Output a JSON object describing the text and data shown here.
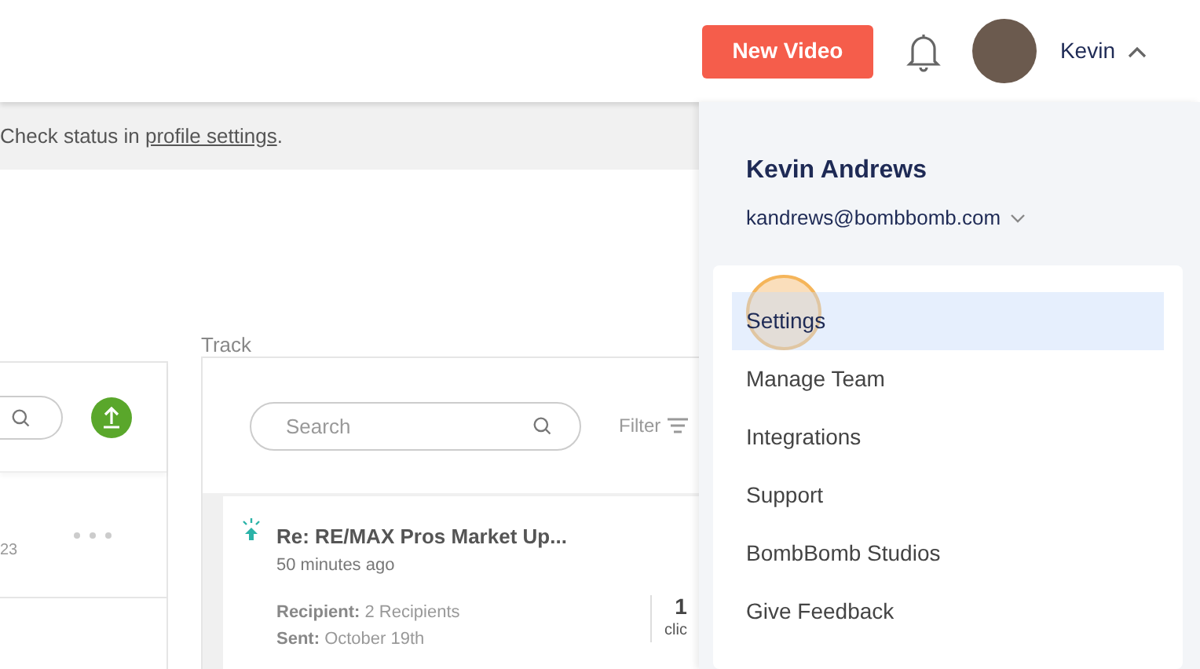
{
  "header": {
    "new_video_button": "New Video",
    "user_name": "Kevin",
    "menu_expanded": true
  },
  "banner": {
    "text": "Check status in ",
    "link": "profile settings",
    "end": "."
  },
  "library": {
    "date_fragment": "23"
  },
  "track": {
    "label": "Track",
    "search": {
      "placeholder": "Search"
    },
    "filter": "Filter",
    "items": [
      {
        "title": "Re: RE/MAX Pros Market Up...",
        "time": "50 minutes ago",
        "recipient_label": "Recipient:",
        "recipient": "2 Recipients",
        "sent_label": "Sent:",
        "sent": "October 19th",
        "stat": "1",
        "stat_label": "clic"
      }
    ]
  },
  "user_menu": {
    "name": "Kevin Andrews",
    "email": "kandrews@bombbomb.com",
    "items": [
      {
        "label": "Settings",
        "selected": true
      },
      {
        "label": "Manage Team",
        "selected": false
      },
      {
        "label": "Integrations",
        "selected": false
      },
      {
        "label": "Support",
        "selected": false
      },
      {
        "label": "BombBomb Studios",
        "selected": false
      },
      {
        "label": "Give Feedback",
        "selected": false
      }
    ]
  }
}
